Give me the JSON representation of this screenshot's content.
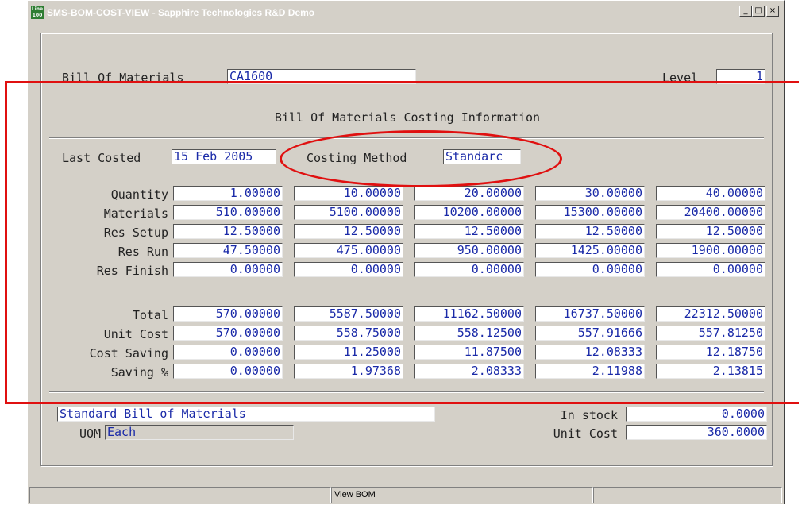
{
  "window": {
    "title": "SMS-BOM-COST-VIEW - Sapphire Technologies R&D Demo",
    "icon_text": "Line 100",
    "icon_name": "app-icon",
    "min_label": "_",
    "max_label": "□",
    "close_label": "×"
  },
  "header": {
    "bom_label": "Bill Of Materials",
    "bom_value": "CA1600",
    "level_label": "Level",
    "level_value": "1"
  },
  "section_title": "Bill Of Materials Costing Information",
  "costing": {
    "last_costed_label": "Last Costed",
    "last_costed_value": "15 Feb 2005",
    "method_label": "Costing Method",
    "method_value": "Standarc"
  },
  "rows_top": [
    {
      "label": "Quantity",
      "values": [
        "1.00000",
        "10.00000",
        "20.00000",
        "30.00000",
        "40.00000"
      ]
    },
    {
      "label": "Materials",
      "values": [
        "510.00000",
        "5100.00000",
        "10200.00000",
        "15300.00000",
        "20400.00000"
      ]
    },
    {
      "label": "Res Setup",
      "values": [
        "12.50000",
        "12.50000",
        "12.50000",
        "12.50000",
        "12.50000"
      ]
    },
    {
      "label": "Res Run",
      "values": [
        "47.50000",
        "475.00000",
        "950.00000",
        "1425.00000",
        "1900.00000"
      ]
    },
    {
      "label": "Res Finish",
      "values": [
        "0.00000",
        "0.00000",
        "0.00000",
        "0.00000",
        "0.00000"
      ]
    }
  ],
  "rows_bottom": [
    {
      "label": "Total",
      "values": [
        "570.00000",
        "5587.50000",
        "11162.50000",
        "16737.50000",
        "22312.50000"
      ]
    },
    {
      "label": "Unit Cost",
      "values": [
        "570.00000",
        "558.75000",
        "558.12500",
        "557.91666",
        "557.81250"
      ]
    },
    {
      "label": "Cost Saving",
      "values": [
        "0.00000",
        "11.25000",
        "11.87500",
        "12.08333",
        "12.18750"
      ]
    },
    {
      "label": "Saving %",
      "values": [
        "0.00000",
        "1.97368",
        "2.08333",
        "2.11988",
        "2.13815"
      ]
    }
  ],
  "footer": {
    "description": "Standard Bill of Materials",
    "uom_label": "UOM",
    "uom_value": "Each",
    "in_stock_label": "In stock",
    "in_stock_value": "0.0000",
    "unit_cost_label": "Unit Cost",
    "unit_cost_value": "360.0000"
  },
  "status": {
    "left": "",
    "center": "View BOM",
    "right": ""
  },
  "colors": {
    "annotation": "#e01010",
    "field_text": "#1a2aa8",
    "window_bg": "#d4d0c8"
  }
}
